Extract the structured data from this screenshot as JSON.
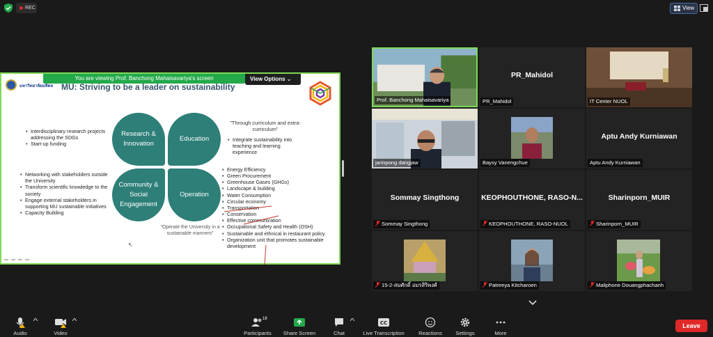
{
  "topbar": {
    "rec_label": "REC",
    "view_label": "View"
  },
  "share": {
    "banner_text": "You are viewing  Prof. Banchong Mahaisavariya's screen",
    "view_options_label": "View Options",
    "slide": {
      "logo_text": "มหาวิทยาลัยมหิดล",
      "title": "MU: Striving to be a leader on sustainability",
      "petals": [
        "Research & Innovation",
        "Education",
        "Community & Social Engagement",
        "Operation"
      ],
      "research_bullets": [
        "Interdisciplinary research projects addressing the SDGs",
        "Start-up funding"
      ],
      "community_bullets": [
        "Networking with stakeholders outside the University",
        "Transform scientific knowledge to the society",
        "Engage external stakeholders in supporting MU sustainable initiatives",
        "Capacity Building"
      ],
      "education_quote": "\"Through curriculum and extra-curriculum\"",
      "education_bullets": [
        "Integrate sustainability into teaching and learning experience"
      ],
      "operation_bullets": [
        "Energy Efficiency",
        "Green Procurement",
        "Greenhouse Gases (GHGs)",
        "Landscape & building",
        "Water Consumption",
        "Circular economy",
        "Transportation",
        "Conservation",
        "Effective communication",
        "Occupational Safety and Health (OSH)",
        "Sustainable and ethnical in restaurant policy",
        "Organization unit that promotes sustainable development"
      ],
      "operation_quote": "\"Operate the University in a sustainable manners\""
    }
  },
  "participants": [
    {
      "name": "Prof. Banchong Mahaisavariya",
      "muted": false,
      "video": true,
      "active": true
    },
    {
      "name": "PR_Mahidol",
      "muted": false,
      "video": false
    },
    {
      "name": "IT Center NUOL",
      "muted": false,
      "video": true
    },
    {
      "name": "jarinpong dangjaw",
      "muted": false,
      "video": true
    },
    {
      "name": "Baysy Vanengchue",
      "muted": false,
      "video": true
    },
    {
      "name": "Aptu Andy Kurniawan",
      "muted": false,
      "video": false
    },
    {
      "name": "Sommay Singthong",
      "muted": true,
      "video": false
    },
    {
      "name": "KEOPHOUTHONE, RASO-NUOL",
      "big_name": "KEOPHOUTHONE, RASO-N...",
      "muted": true,
      "video": false
    },
    {
      "name": "Sharinporn_MUIR",
      "muted": true,
      "video": false
    },
    {
      "name": "15-2-สมศักดิ์ อมรสิริพงศ์",
      "muted": true,
      "video": true
    },
    {
      "name": "Patreeya Kitcharoen",
      "muted": true,
      "video": true
    },
    {
      "name": "Maliphone Douangphachanh",
      "muted": true,
      "video": true
    }
  ],
  "toolbar": {
    "audio_label": "Audio",
    "video_label": "Video",
    "participants_label": "Participants",
    "participants_count": "18",
    "share_label": "Share Screen",
    "chat_label": "Chat",
    "transcription_label": "Live Transcription",
    "reactions_label": "Reactions",
    "settings_label": "Settings",
    "more_label": "More",
    "leave_label": "Leave"
  },
  "colors": {
    "accent_green": "#7ed957",
    "share_green": "#23a94a",
    "petal_teal": "#2d7f78",
    "leave_red": "#e02828"
  }
}
